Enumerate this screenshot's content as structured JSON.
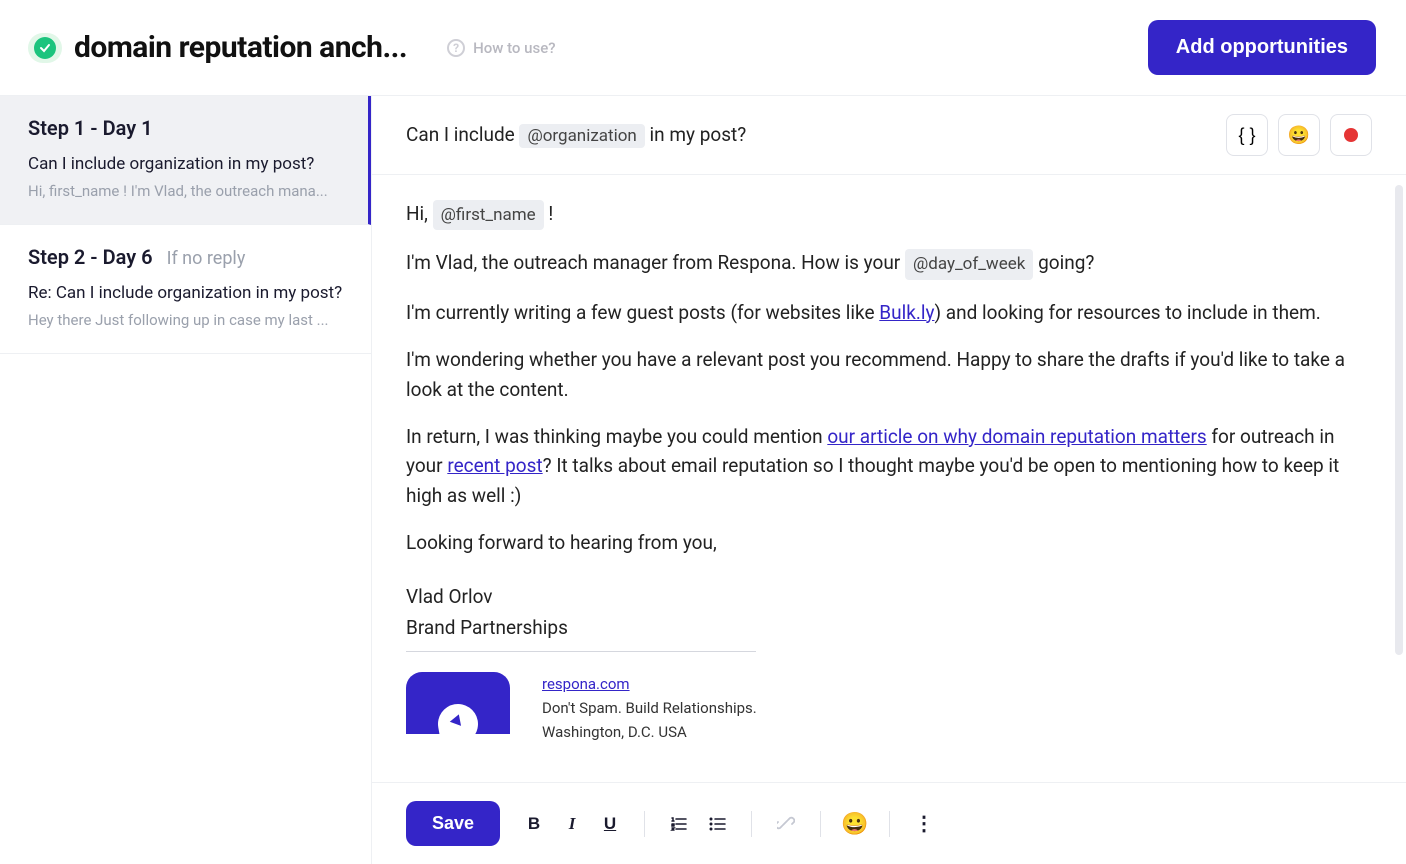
{
  "header": {
    "title": "domain reputation anch...",
    "how_to": "How to use?",
    "add_button": "Add opportunities"
  },
  "sidebar": {
    "steps": [
      {
        "title": "Step 1 - Day 1",
        "condition": "",
        "subject": "Can I include organization in my post?",
        "preview": "Hi, first_name ! I'm Vlad, the outreach mana..."
      },
      {
        "title": "Step 2 - Day 6",
        "condition": "If no reply",
        "subject": "Re: Can I include organization in my post?",
        "preview": "Hey there Just following up in case my last ..."
      }
    ]
  },
  "subject": {
    "prefix": "Can I include",
    "var": "@organization",
    "suffix": "in my post?"
  },
  "icons": {
    "braces": "{ }",
    "emoji": "😀"
  },
  "body": {
    "greeting_prefix": "Hi, ",
    "greeting_var": "@first_name",
    "greeting_suffix": " !",
    "intro_before": "I'm Vlad, the outreach manager from Respona. How is your ",
    "intro_var": "@day_of_week",
    "intro_after": " going?",
    "p2_before": "I'm currently writing a few guest posts (for websites like ",
    "p2_link": "Bulk.ly",
    "p2_after": ") and looking for resources to include in them.",
    "p3": "I'm wondering whether you have a relevant post you recommend. Happy to share the drafts if you'd like to take a look at the content.",
    "p4_before": "In return, I was thinking maybe you could mention ",
    "p4_link1": "our article on why domain reputation matters",
    "p4_mid": " for outreach in your ",
    "p4_link2": "recent post",
    "p4_after": "? It talks about email reputation so I thought maybe you'd be open to mentioning how to keep it high as well :)",
    "closing": "Looking forward to hearing from you,",
    "sig_name": "Vlad Orlov",
    "sig_role": "Brand Partnerships",
    "sig_url": "respona.com",
    "sig_tagline": "Don't Spam. Build Relationships.",
    "sig_location": "Washington, D.C. USA"
  },
  "toolbar": {
    "save": "Save",
    "bold": "B",
    "italic": "I",
    "underline": "U",
    "emoji": "😀",
    "more": "⋮"
  }
}
